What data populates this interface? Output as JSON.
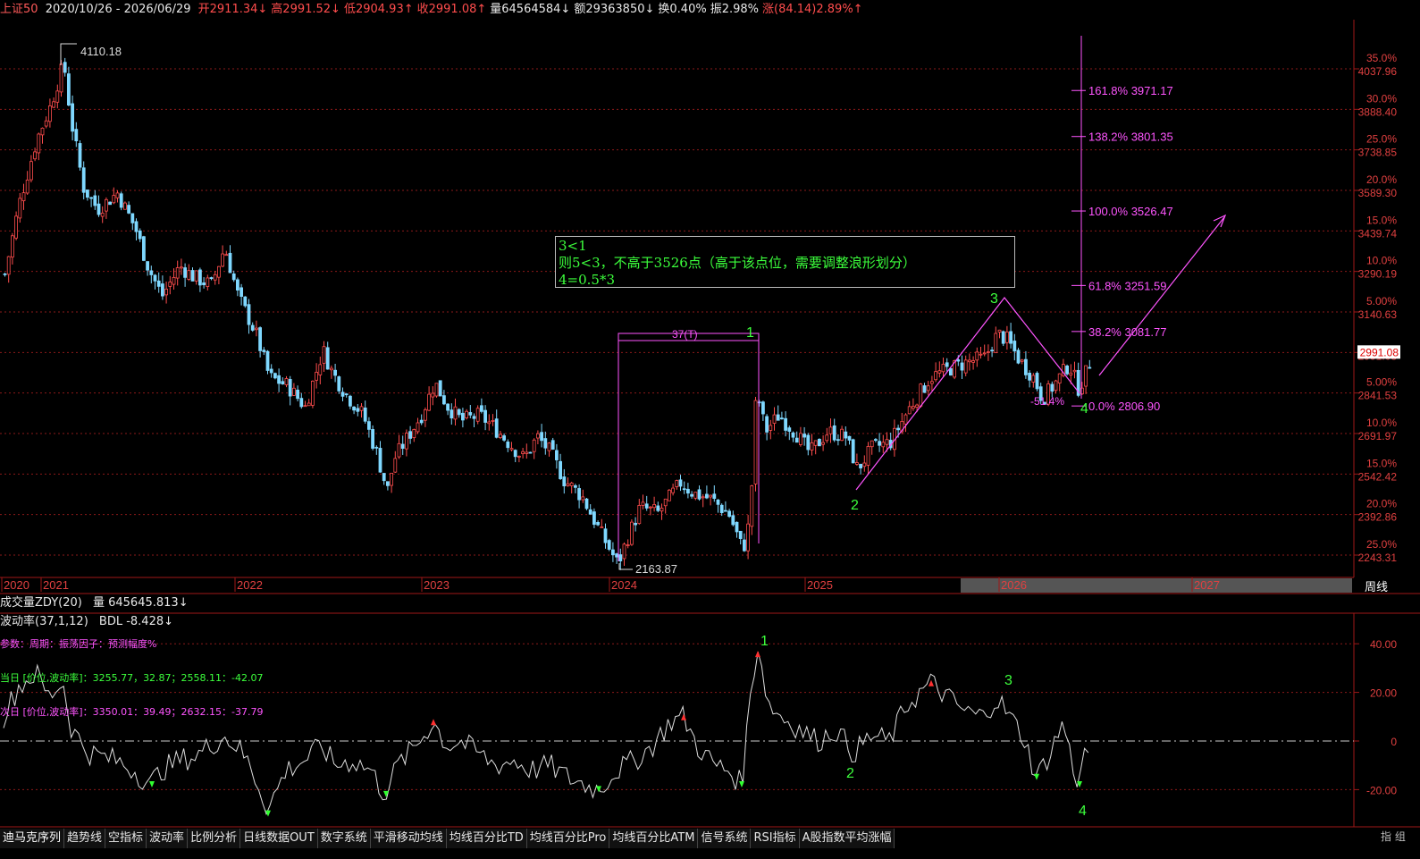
{
  "header": {
    "index_name": "上证50",
    "date_range": "2020/10/26 - 2026/06/29",
    "open": "开2911.34↓",
    "high": "高2991.52↓",
    "low": "低2904.93↑",
    "close": "收2991.08↑",
    "volume": "量64564584↓",
    "amount": "额29363850↓",
    "turnover": "换0.40%",
    "amplitude": "振2.98%",
    "change": "涨(84.14)2.89%↑"
  },
  "annotation_box": {
    "line1": "3<1",
    "line2": "则5<3，不高于3526点（高于该点位，需要调整浪形划分）",
    "line3": "4=0.5*3"
  },
  "price_labels": {
    "high_point": "4110.18",
    "low_point": "2163.87",
    "interval": "37(T)",
    "retrace": "-51.4%"
  },
  "fib_levels": [
    {
      "label": "161.8% 3971.17",
      "price": 3971.17
    },
    {
      "label": "138.2% 3801.35",
      "price": 3801.35
    },
    {
      "label": "100.0% 3526.47",
      "price": 3526.47
    },
    {
      "label": "61.8% 3251.59",
      "price": 3251.59
    },
    {
      "label": "38.2% 3081.77",
      "price": 3081.77
    },
    {
      "label": "0.0% 2806.90",
      "price": 2806.9
    }
  ],
  "wave_labels": [
    "1",
    "2",
    "3",
    "4"
  ],
  "right_axis": [
    {
      "pct": "35.0%",
      "price": "4037.96"
    },
    {
      "pct": "30.0%",
      "price": "3888.40"
    },
    {
      "pct": "25.0%",
      "price": "3738.85"
    },
    {
      "pct": "20.0%",
      "price": "3589.30"
    },
    {
      "pct": "15.0%",
      "price": "3439.74"
    },
    {
      "pct": "10.0%",
      "price": "3290.19"
    },
    {
      "pct": "5.00%",
      "price": "3140.63"
    },
    {
      "pct": "0.00%",
      "price": "2991.08"
    },
    {
      "pct": "5.00%",
      "price": "2841.53"
    },
    {
      "pct": "10.0%",
      "price": "2691.97"
    },
    {
      "pct": "15.0%",
      "price": "2542.42"
    },
    {
      "pct": "20.0%",
      "price": "2392.86"
    },
    {
      "pct": "25.0%",
      "price": "2243.31"
    }
  ],
  "current_price": "2991.08",
  "year_labels": [
    "2020",
    "2021",
    "2022",
    "2023",
    "2024",
    "2025",
    "2026",
    "2027"
  ],
  "period_label": "周线",
  "volume_panel": {
    "name": "成交量ZDY(20)",
    "value": "量 645645.813↓"
  },
  "osc_panel": {
    "name": "波动率(37,1,12)",
    "bdl": "BDL -8.428↓",
    "params": "参数：周期：振荡因子：预测幅度%",
    "today": "当日 [价位,波动率]：3255.77，32.87；2558.11：-42.07",
    "next": "次日 [价位,波动率]：3350.01：39.49；2632.15：-37.79",
    "ticks": [
      "40.00",
      "20.00",
      "0",
      "-20.00"
    ],
    "wave_labels": [
      "1",
      "2",
      "3",
      "4"
    ]
  },
  "bottom_tabs": [
    "迪马克序列",
    "趋势线",
    "空指标",
    "波动率",
    "比例分析",
    "日线数据OUT",
    "数字系统",
    "平滑移动均线",
    "均线百分比TD",
    "均线百分比Pro",
    "均线百分比ATM",
    "信号系统",
    "RSI指标",
    "A股指数平均涨幅"
  ],
  "bottom_right": "指 组",
  "colors": {
    "up": "#ff4d4d",
    "down": "#7fd8ff",
    "grid": "#8b1a1a",
    "fib": "#ff55ff",
    "wave": "#3cff3c"
  }
}
